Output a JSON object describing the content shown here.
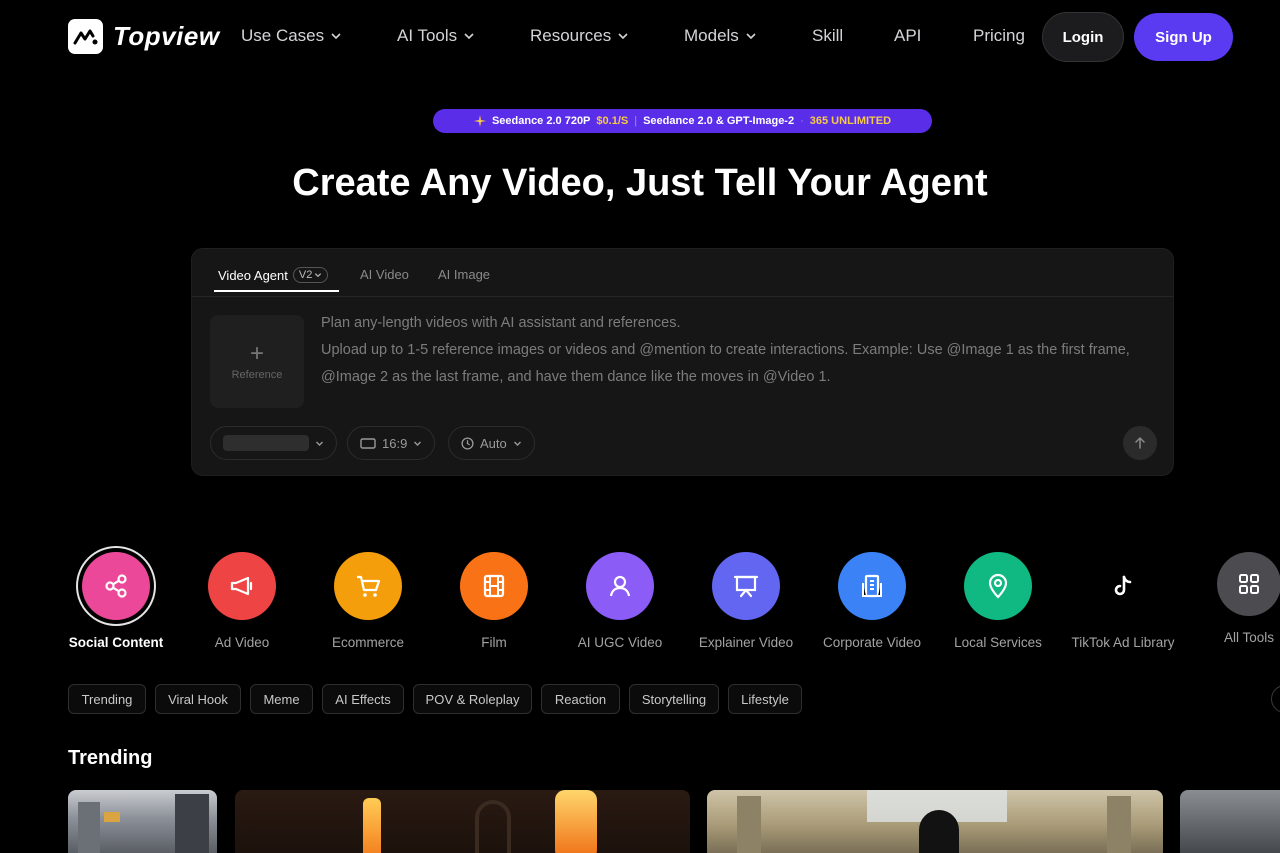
{
  "nav": {
    "brand": "Topview",
    "items": [
      {
        "label": "Use Cases",
        "dropdown": true
      },
      {
        "label": "AI Tools",
        "dropdown": true
      },
      {
        "label": "Resources",
        "dropdown": true
      },
      {
        "label": "Models",
        "dropdown": true
      },
      {
        "label": "Skill",
        "dropdown": false
      },
      {
        "label": "API",
        "dropdown": false
      },
      {
        "label": "Pricing",
        "dropdown": false
      }
    ],
    "login": "Login",
    "signup": "Sign Up"
  },
  "promo": {
    "part1": "Seedance 2.0 720P",
    "price": "$0.1/S",
    "divider": "|",
    "part2": "Seedance 2.0 & GPT-Image-2",
    "dot": "·",
    "part3": "365 UNLIMITED"
  },
  "hero": {
    "title": "Create Any Video, Just Tell Your Agent"
  },
  "panel": {
    "tabs": [
      {
        "label": "Video Agent",
        "badge": "V2",
        "active": true
      },
      {
        "label": "AI Video",
        "active": false
      },
      {
        "label": "AI Image",
        "active": false
      }
    ],
    "reference": {
      "plus": "+",
      "label": "Reference"
    },
    "prompt_placeholder_line1": "Plan any-length videos with AI assistant and references.",
    "prompt_placeholder_line2": "Upload up to 1-5 reference images or videos and @mention to create interactions. Example: Use @Image 1 as the first frame, @Image 2 as the last frame, and have them dance like the moves in @Video 1.",
    "aspect": "16:9",
    "duration": "Auto"
  },
  "categories": [
    {
      "label": "Social Content",
      "icon": "share-icon",
      "color": "#ec4899",
      "active": true
    },
    {
      "label": "Ad Video",
      "icon": "megaphone-icon",
      "color": "#ef4444",
      "active": false
    },
    {
      "label": "Ecommerce",
      "icon": "cart-icon",
      "color": "#f59e0b",
      "active": false
    },
    {
      "label": "Film",
      "icon": "film-icon",
      "color": "#f97316",
      "active": false
    },
    {
      "label": "AI UGC Video",
      "icon": "person-icon",
      "color": "#8b5cf6",
      "active": false
    },
    {
      "label": "Explainer Video",
      "icon": "presentation-icon",
      "color": "#6366f1",
      "active": false
    },
    {
      "label": "Corporate Video",
      "icon": "building-icon",
      "color": "#3b82f6",
      "active": false
    },
    {
      "label": "Local Services",
      "icon": "location-pin-icon",
      "color": "#10b981",
      "active": false
    },
    {
      "label": "TikTok Ad Library",
      "icon": "tiktok-icon",
      "color": "#000000",
      "active": false
    },
    {
      "label": "All Tools",
      "icon": "grid-icon",
      "color": "#4b4b50",
      "active": false
    }
  ],
  "chips": [
    "Trending",
    "Viral Hook",
    "Meme",
    "AI Effects",
    "POV & Roleplay",
    "Reaction",
    "Storytelling",
    "Lifestyle"
  ],
  "section": {
    "title": "Trending"
  }
}
